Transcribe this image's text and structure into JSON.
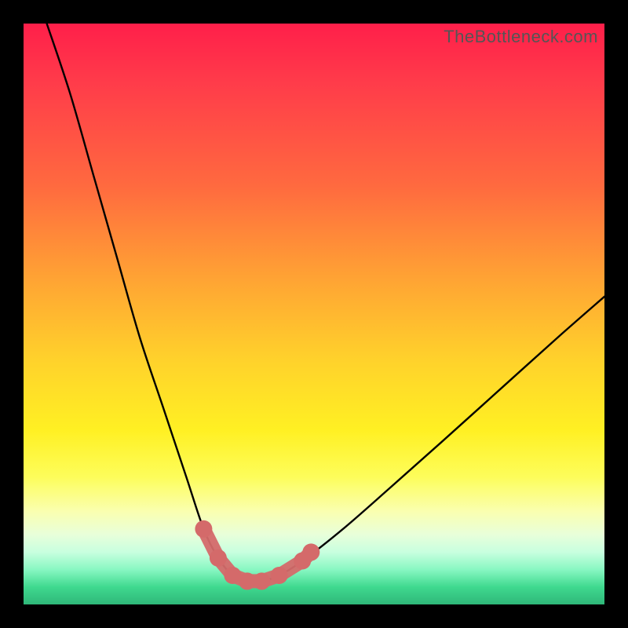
{
  "watermark": "TheBottleneck.com",
  "colors": {
    "page_bg": "#000000",
    "curve": "#000000",
    "marker": "#d46a6a",
    "gradient_top": "#ff1f4a",
    "gradient_bottom": "#2fb779"
  },
  "chart_data": {
    "type": "line",
    "title": "",
    "xlabel": "",
    "ylabel": "",
    "xlim": [
      0,
      100
    ],
    "ylim": [
      0,
      100
    ],
    "grid": false,
    "legend": false,
    "annotations": [],
    "series": [
      {
        "name": "bottleneck-curve",
        "x": [
          4,
          8,
          12,
          16,
          20,
          24,
          28,
          31,
          33.5,
          36,
          38.5,
          41,
          44,
          48,
          55,
          63,
          72,
          82,
          92,
          100
        ],
        "values": [
          100,
          88,
          74,
          60,
          46,
          34,
          22,
          13,
          8,
          5,
          4,
          4,
          5,
          7.5,
          13,
          20,
          28,
          37,
          46,
          53
        ]
      }
    ],
    "markers": [
      {
        "name": "marker-left-upper",
        "x": 31.0,
        "y": 13.0
      },
      {
        "name": "marker-left-mid",
        "x": 33.5,
        "y": 8.0
      },
      {
        "name": "marker-trough-1",
        "x": 36.0,
        "y": 5.0
      },
      {
        "name": "marker-trough-2",
        "x": 38.5,
        "y": 4.0
      },
      {
        "name": "marker-trough-3",
        "x": 41.0,
        "y": 4.0
      },
      {
        "name": "marker-trough-4",
        "x": 44.0,
        "y": 5.0
      },
      {
        "name": "marker-right-mid",
        "x": 48.0,
        "y": 7.5
      },
      {
        "name": "marker-right-upper",
        "x": 49.5,
        "y": 9.0
      }
    ]
  }
}
